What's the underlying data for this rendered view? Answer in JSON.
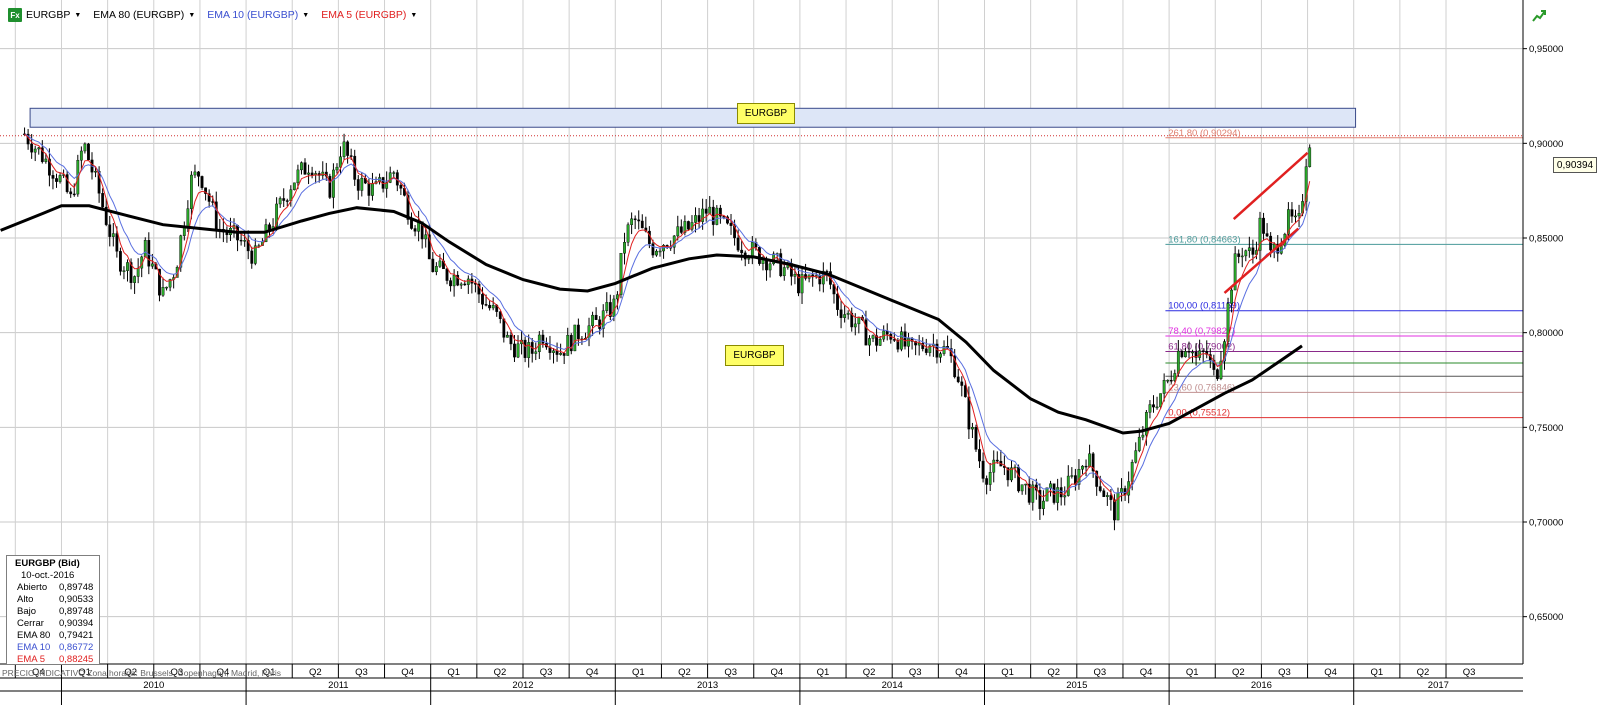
{
  "toolbar": {
    "fx_icon": "Fx",
    "symbol": "EURGBP",
    "indicators": [
      {
        "label": "EMA 80 (EURGBP)",
        "color": "#000000"
      },
      {
        "label": "EMA 10 (EURGBP)",
        "color": "#3a4fd0"
      },
      {
        "label": "EMA 5 (EURGBP)",
        "color": "#e02020"
      }
    ],
    "trend_icon": "trend-up-icon"
  },
  "info": {
    "title": "EURGBP (Bid)",
    "date": "10-oct.-2016",
    "rows": [
      {
        "k": "Abierto",
        "v": "0,89748",
        "color": "#000000"
      },
      {
        "k": "Alto",
        "v": "0,90533",
        "color": "#000000"
      },
      {
        "k": "Bajo",
        "v": "0,89748",
        "color": "#000000"
      },
      {
        "k": "Cerrar",
        "v": "0,90394",
        "color": "#000000"
      },
      {
        "k": "EMA 80",
        "v": "0,79421",
        "color": "#000000"
      },
      {
        "k": "EMA 10",
        "v": "0,86772",
        "color": "#3a4fd0"
      },
      {
        "k": "EMA 5",
        "v": "0,88245",
        "color": "#e02020"
      }
    ]
  },
  "footer_note": "PRECIO INDICATIVO   Zona horaria: Brussels, Copenhagen, Madrid, Paris",
  "labels": {
    "box1": "EURGBP",
    "box2": "EURGBP"
  },
  "current_price": "0,90394",
  "chart_data": {
    "type": "candlestick",
    "symbol": "EURGBP",
    "ylim": [
      0.625,
      0.9757
    ],
    "y_ticks": [
      0.95,
      0.9,
      0.85,
      0.8,
      0.75,
      0.7,
      0.65
    ],
    "y_tick_labels": [
      "0,95000",
      "0,90000",
      "0,85000",
      "0,80000",
      "0,75000",
      "0,70000",
      "0,65000"
    ],
    "x_range": [
      2009.667,
      2017.917
    ],
    "quarter_ticks": [
      "Q4",
      "Q1",
      "Q2",
      "Q3",
      "Q4",
      "Q1",
      "Q2",
      "Q3",
      "Q4",
      "Q1",
      "Q2",
      "Q3",
      "Q4",
      "Q1",
      "Q2",
      "Q3",
      "Q4",
      "Q1",
      "Q2",
      "Q3",
      "Q4",
      "Q1",
      "Q2",
      "Q3",
      "Q4",
      "Q1",
      "Q2",
      "Q3",
      "Q4",
      "Q1",
      "Q2",
      "Q3"
    ],
    "quarter_tick_t": [
      2009.75,
      2010.0,
      2010.25,
      2010.5,
      2010.75,
      2011.0,
      2011.25,
      2011.5,
      2011.75,
      2012.0,
      2012.25,
      2012.5,
      2012.75,
      2013.0,
      2013.25,
      2013.5,
      2013.75,
      2014.0,
      2014.25,
      2014.5,
      2014.75,
      2015.0,
      2015.25,
      2015.5,
      2015.75,
      2016.0,
      2016.25,
      2016.5,
      2016.75,
      2017.0,
      2017.25,
      2017.5
    ],
    "years": [
      "2010",
      "2011",
      "2012",
      "2013",
      "2014",
      "2015",
      "2016",
      "2017"
    ],
    "close_path": [
      [
        2009.8,
        0.905
      ],
      [
        2009.9,
        0.893
      ],
      [
        2010.0,
        0.88
      ],
      [
        2010.05,
        0.87
      ],
      [
        2010.12,
        0.9
      ],
      [
        2010.2,
        0.875
      ],
      [
        2010.3,
        0.84
      ],
      [
        2010.4,
        0.83
      ],
      [
        2010.45,
        0.845
      ],
      [
        2010.55,
        0.82
      ],
      [
        2010.62,
        0.835
      ],
      [
        2010.7,
        0.88
      ],
      [
        2010.75,
        0.885
      ],
      [
        2010.85,
        0.855
      ],
      [
        2010.95,
        0.85
      ],
      [
        2011.05,
        0.84
      ],
      [
        2011.15,
        0.86
      ],
      [
        2011.25,
        0.88
      ],
      [
        2011.35,
        0.89
      ],
      [
        2011.45,
        0.875
      ],
      [
        2011.52,
        0.9
      ],
      [
        2011.6,
        0.88
      ],
      [
        2011.7,
        0.875
      ],
      [
        2011.8,
        0.885
      ],
      [
        2011.9,
        0.86
      ],
      [
        2011.95,
        0.855
      ],
      [
        2012.0,
        0.835
      ],
      [
        2012.1,
        0.83
      ],
      [
        2012.2,
        0.83
      ],
      [
        2012.3,
        0.815
      ],
      [
        2012.35,
        0.81
      ],
      [
        2012.42,
        0.795
      ],
      [
        2012.5,
        0.79
      ],
      [
        2012.55,
        0.79
      ],
      [
        2012.6,
        0.8
      ],
      [
        2012.7,
        0.79
      ],
      [
        2012.8,
        0.8
      ],
      [
        2012.9,
        0.805
      ],
      [
        2013.0,
        0.815
      ],
      [
        2013.05,
        0.85
      ],
      [
        2013.1,
        0.86
      ],
      [
        2013.2,
        0.845
      ],
      [
        2013.3,
        0.85
      ],
      [
        2013.4,
        0.855
      ],
      [
        2013.5,
        0.865
      ],
      [
        2013.6,
        0.855
      ],
      [
        2013.7,
        0.845
      ],
      [
        2013.8,
        0.84
      ],
      [
        2013.9,
        0.835
      ],
      [
        2014.0,
        0.825
      ],
      [
        2014.1,
        0.83
      ],
      [
        2014.15,
        0.83
      ],
      [
        2014.2,
        0.815
      ],
      [
        2014.3,
        0.805
      ],
      [
        2014.4,
        0.795
      ],
      [
        2014.5,
        0.8
      ],
      [
        2014.6,
        0.79
      ],
      [
        2014.7,
        0.795
      ],
      [
        2014.8,
        0.79
      ],
      [
        2014.85,
        0.78
      ],
      [
        2014.9,
        0.76
      ],
      [
        2014.95,
        0.74
      ],
      [
        2015.0,
        0.725
      ],
      [
        2015.1,
        0.73
      ],
      [
        2015.2,
        0.72
      ],
      [
        2015.3,
        0.71
      ],
      [
        2015.35,
        0.715
      ],
      [
        2015.42,
        0.715
      ],
      [
        2015.5,
        0.725
      ],
      [
        2015.55,
        0.735
      ],
      [
        2015.6,
        0.725
      ],
      [
        2015.7,
        0.705
      ],
      [
        2015.75,
        0.715
      ],
      [
        2015.8,
        0.73
      ],
      [
        2015.9,
        0.76
      ],
      [
        2016.0,
        0.775
      ],
      [
        2016.05,
        0.79
      ],
      [
        2016.1,
        0.795
      ],
      [
        2016.15,
        0.785
      ],
      [
        2016.2,
        0.79
      ],
      [
        2016.25,
        0.775
      ],
      [
        2016.3,
        0.8
      ],
      [
        2016.35,
        0.835
      ],
      [
        2016.4,
        0.845
      ],
      [
        2016.45,
        0.84
      ],
      [
        2016.5,
        0.86
      ],
      [
        2016.55,
        0.84
      ],
      [
        2016.6,
        0.85
      ],
      [
        2016.65,
        0.86
      ],
      [
        2016.7,
        0.855
      ],
      [
        2016.72,
        0.87
      ],
      [
        2016.75,
        0.9
      ],
      [
        2016.77,
        0.904
      ]
    ],
    "ema80_path": [
      [
        2009.67,
        0.854
      ],
      [
        2009.9,
        0.863
      ],
      [
        2010.0,
        0.867
      ],
      [
        2010.15,
        0.867
      ],
      [
        2010.35,
        0.862
      ],
      [
        2010.55,
        0.857
      ],
      [
        2010.75,
        0.855
      ],
      [
        2010.95,
        0.853
      ],
      [
        2011.1,
        0.853
      ],
      [
        2011.3,
        0.859
      ],
      [
        2011.45,
        0.863
      ],
      [
        2011.6,
        0.866
      ],
      [
        2011.8,
        0.864
      ],
      [
        2011.95,
        0.858
      ],
      [
        2012.1,
        0.848
      ],
      [
        2012.3,
        0.836
      ],
      [
        2012.5,
        0.828
      ],
      [
        2012.7,
        0.823
      ],
      [
        2012.85,
        0.822
      ],
      [
        2013.0,
        0.826
      ],
      [
        2013.2,
        0.834
      ],
      [
        2013.4,
        0.839
      ],
      [
        2013.55,
        0.841
      ],
      [
        2013.75,
        0.84
      ],
      [
        2013.95,
        0.836
      ],
      [
        2014.15,
        0.831
      ],
      [
        2014.35,
        0.823
      ],
      [
        2014.55,
        0.815
      ],
      [
        2014.75,
        0.807
      ],
      [
        2014.9,
        0.795
      ],
      [
        2015.05,
        0.78
      ],
      [
        2015.25,
        0.765
      ],
      [
        2015.4,
        0.758
      ],
      [
        2015.55,
        0.754
      ],
      [
        2015.75,
        0.747
      ],
      [
        2015.85,
        0.748
      ],
      [
        2016.0,
        0.752
      ],
      [
        2016.15,
        0.76
      ],
      [
        2016.3,
        0.768
      ],
      [
        2016.45,
        0.775
      ],
      [
        2016.6,
        0.785
      ],
      [
        2016.72,
        0.793
      ]
    ],
    "channel_lines": [
      {
        "from": [
          2016.3,
          0.821
        ],
        "to": [
          2016.7,
          0.855
        ],
        "color": "#e02020"
      },
      {
        "from": [
          2016.35,
          0.86
        ],
        "to": [
          2016.75,
          0.895
        ],
        "color": "#e02020"
      }
    ],
    "resistance_zone": {
      "t0": 2009.83,
      "t1": 2017.01,
      "y0": 0.9085,
      "y1": 0.9185,
      "color": "#dde6f7"
    },
    "fibonacci": [
      {
        "label": "261,80 (0,90294)",
        "value": 0.90294,
        "color": "#e08070"
      },
      {
        "label": "161,80 (0,84663)",
        "value": 0.84663,
        "color": "#4a9a9a"
      },
      {
        "label": "100,00 (0,81159)",
        "value": 0.81159,
        "color": "#2a2ae0"
      },
      {
        "label": "78,40 (0,79827)",
        "value": 0.79827,
        "color": "#e030e0"
      },
      {
        "label": "61,80 (0,79002)",
        "value": 0.79002,
        "color": "#8a2a8a"
      },
      {
        "label": "",
        "value": 0.784,
        "color": "#2a8a2a"
      },
      {
        "label": "",
        "value": 0.777,
        "color": "#555555"
      },
      {
        "label": "23,60 (0,76846)",
        "value": 0.76846,
        "color": "#c09090"
      },
      {
        "label": "0,00 (0,75512)",
        "value": 0.75512,
        "color": "#e03030"
      }
    ]
  }
}
